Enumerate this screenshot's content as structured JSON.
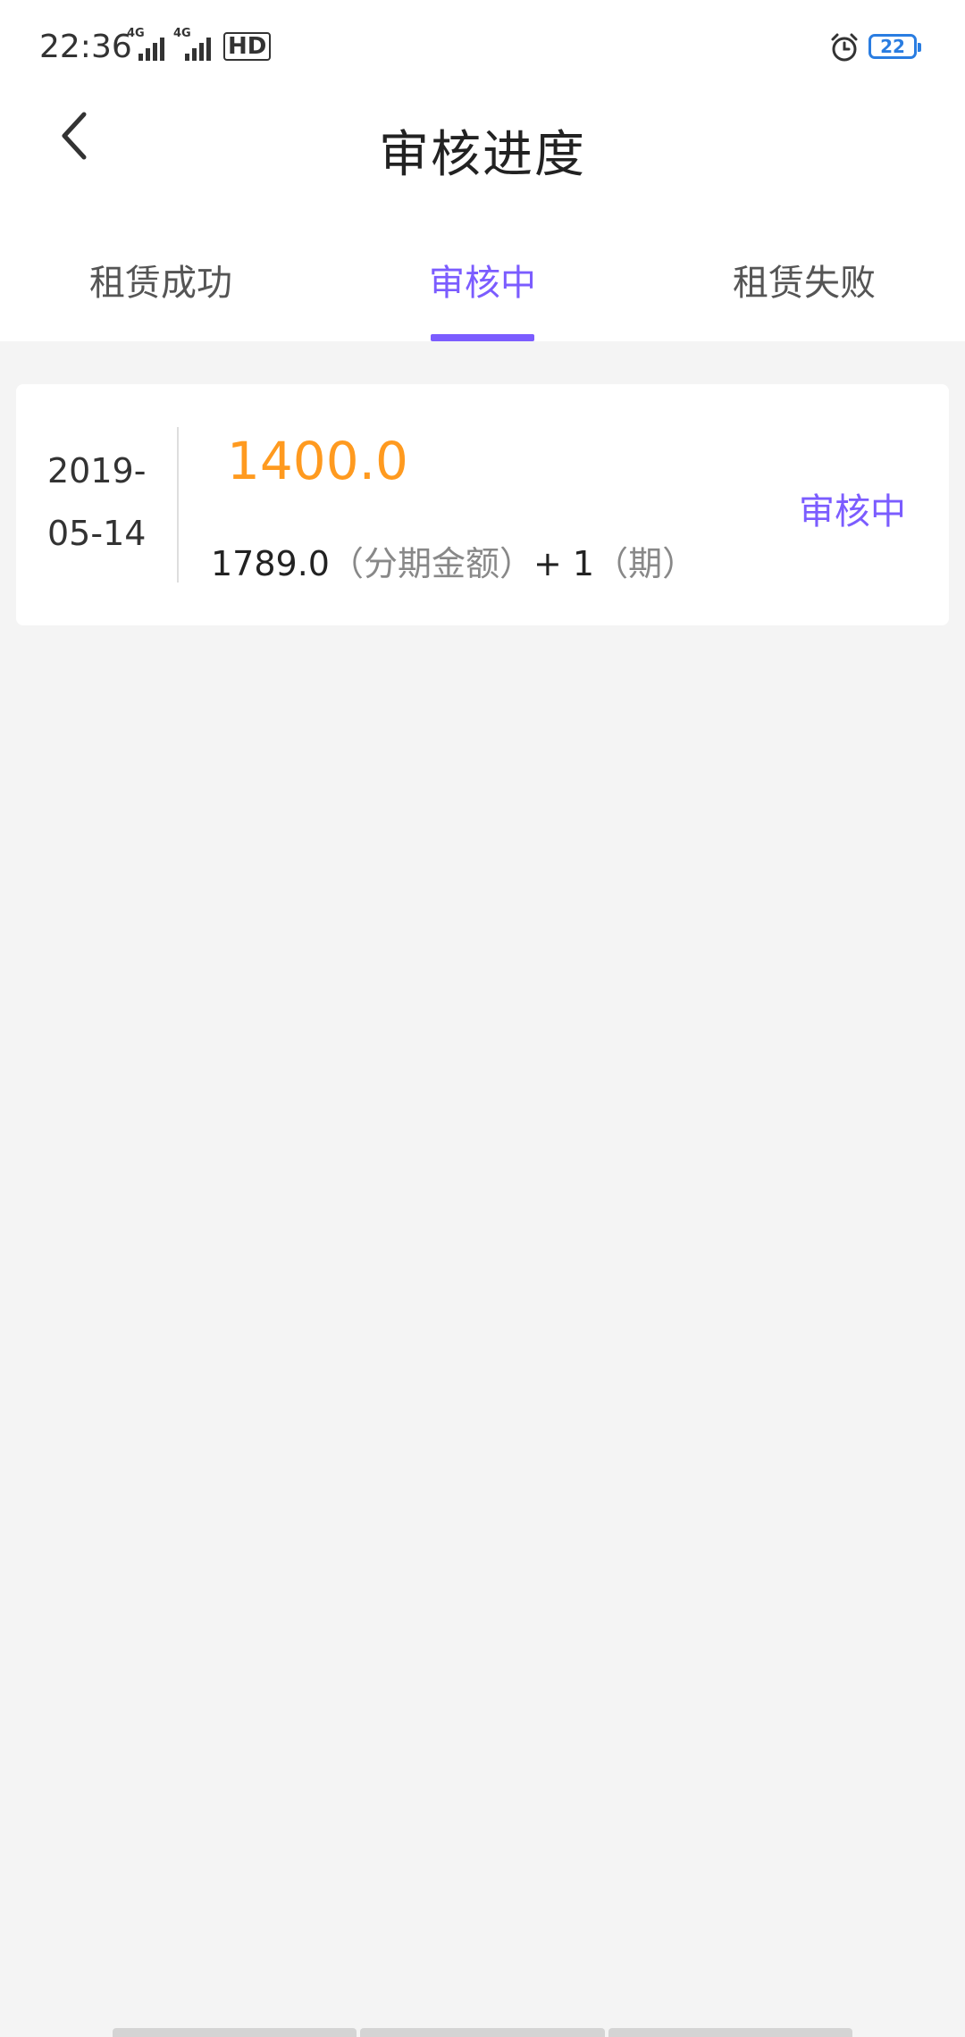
{
  "status_bar": {
    "time": "22:36",
    "sim1_network": "4G",
    "sim2_network": "4G",
    "hd_label": "HD",
    "battery_level": "22"
  },
  "header": {
    "title": "审核进度",
    "back_icon": "chevron-left-icon"
  },
  "tabs": [
    {
      "label": "租赁成功",
      "active": false
    },
    {
      "label": "审核中",
      "active": true
    },
    {
      "label": "租赁失败",
      "active": false
    }
  ],
  "records": [
    {
      "date_line1": "2019-",
      "date_line2": "05-14",
      "amount": "1400.0",
      "installment_amount": "1789.0",
      "installment_amount_label": "（分期金额）",
      "plus": "+",
      "periods": "1",
      "periods_label": "（期）",
      "status": "审核中"
    }
  ],
  "colors": {
    "accent": "#7b5cff",
    "amount": "#ff9a1f",
    "background": "#f4f4f4",
    "battery": "#2a7de1"
  }
}
